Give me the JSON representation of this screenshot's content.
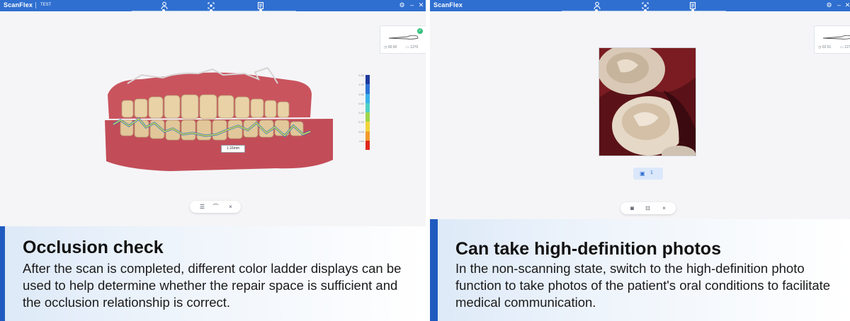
{
  "panels": [
    {
      "app_name": "ScanFlex",
      "project_name": "TEST",
      "steps": [
        "patient-icon",
        "scan-icon",
        "report-icon"
      ],
      "scanner_card": {
        "time": "00:00",
        "count": "1270"
      },
      "legend": {
        "labels": [
          "0.20",
          "1.00",
          "0.80",
          "0.60",
          "0.40",
          "0.20",
          "0.00",
          "mm"
        ],
        "colors": [
          "#1d3a9c",
          "#2d74d6",
          "#3ab3e8",
          "#4fd0c4",
          "#9fd64a",
          "#f2d33a",
          "#f29a2e",
          "#e0281e"
        ]
      },
      "measurement": "1.16mm",
      "toolbar": [
        "layers-icon",
        "jaw-icon",
        "close-icon"
      ],
      "caption": {
        "title": "Occlusion check",
        "body": "After the scan is completed, different color ladder displays can be used to help determine whether the repair space is sufficient and the occlusion relationship is correct."
      }
    },
    {
      "app_name": "ScanFlex",
      "steps": [
        "patient-icon",
        "scan-icon",
        "report-icon"
      ],
      "scanner_card": {
        "time": "02:01",
        "count": "1276"
      },
      "photo_count": "1",
      "toolbar": [
        "camera-icon",
        "focus-icon",
        "close-icon"
      ],
      "caption": {
        "title": "Can take high-definition photos",
        "body": "In the non-scanning state, switch to the high-definition photo function to take photos of the patient's oral conditions to facilitate medical communication."
      }
    }
  ],
  "colors": {
    "titlebar": "#2f6fd0",
    "accent": "#1f5bbf",
    "occlusion_line_1": "#2b7bd6",
    "occlusion_line_2": "#f5e12b"
  }
}
